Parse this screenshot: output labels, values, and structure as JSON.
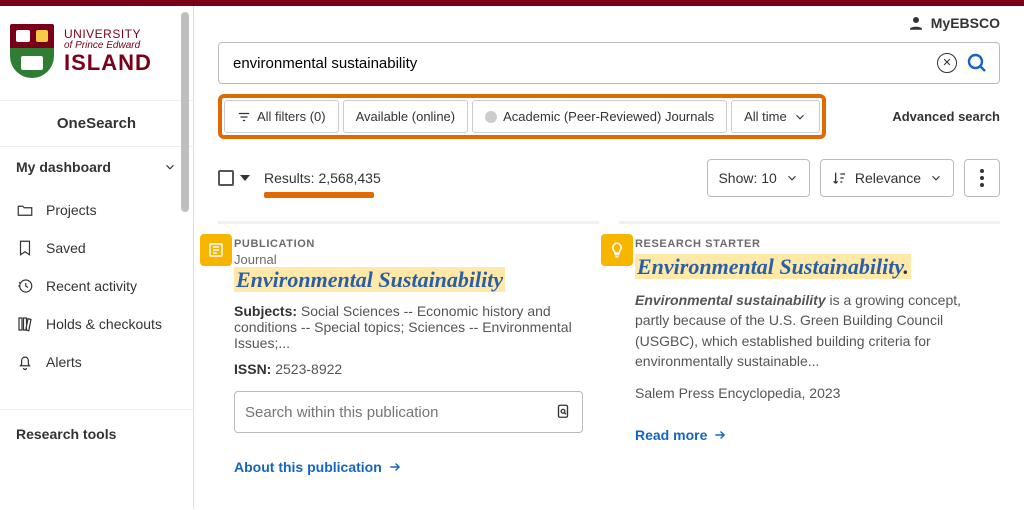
{
  "account_label": "MyEBSCO",
  "brand": {
    "l1": "UNIVERSITY",
    "l2": "of Prince Edward",
    "l3": "ISLAND"
  },
  "sidebar": {
    "product": "OneSearch",
    "dashboard_label": "My dashboard",
    "items": [
      {
        "label": "Projects"
      },
      {
        "label": "Saved"
      },
      {
        "label": "Recent activity"
      },
      {
        "label": "Holds & checkouts"
      },
      {
        "label": "Alerts"
      }
    ],
    "tools_label": "Research tools"
  },
  "search": {
    "query": "environmental sustainability",
    "advanced": "Advanced search"
  },
  "chips": {
    "all_filters": "All filters (0)",
    "available": "Available (online)",
    "peer": "Academic (Peer-Reviewed) Journals",
    "alltime": "All time"
  },
  "results": {
    "label_prefix": "Results: ",
    "count": "2,568,435",
    "show_label": "Show: 10",
    "sort_label": "Relevance"
  },
  "cards": {
    "pub": {
      "tag": "PUBLICATION",
      "type": "Journal",
      "title": "Environmental Sustainability",
      "subjects_label": "Subjects:",
      "subjects": "Social Sciences -- Economic history and conditions -- Special topics; Sciences -- Environmental Issues;...",
      "issn_label": "ISSN:",
      "issn": "2523-8922",
      "search_within_placeholder": "Search within this publication",
      "about": "About this publication"
    },
    "starter": {
      "tag": "RESEARCH STARTER",
      "title": "Environmental Sustainability",
      "bold_lead": "Environmental sustainability",
      "body": " is a growing concept, partly because of the U.S. Green Building Council (USGBC), which established building criteria for environmentally sustainable...",
      "source": "Salem Press Encyclopedia, 2023",
      "read_more": "Read more"
    }
  }
}
